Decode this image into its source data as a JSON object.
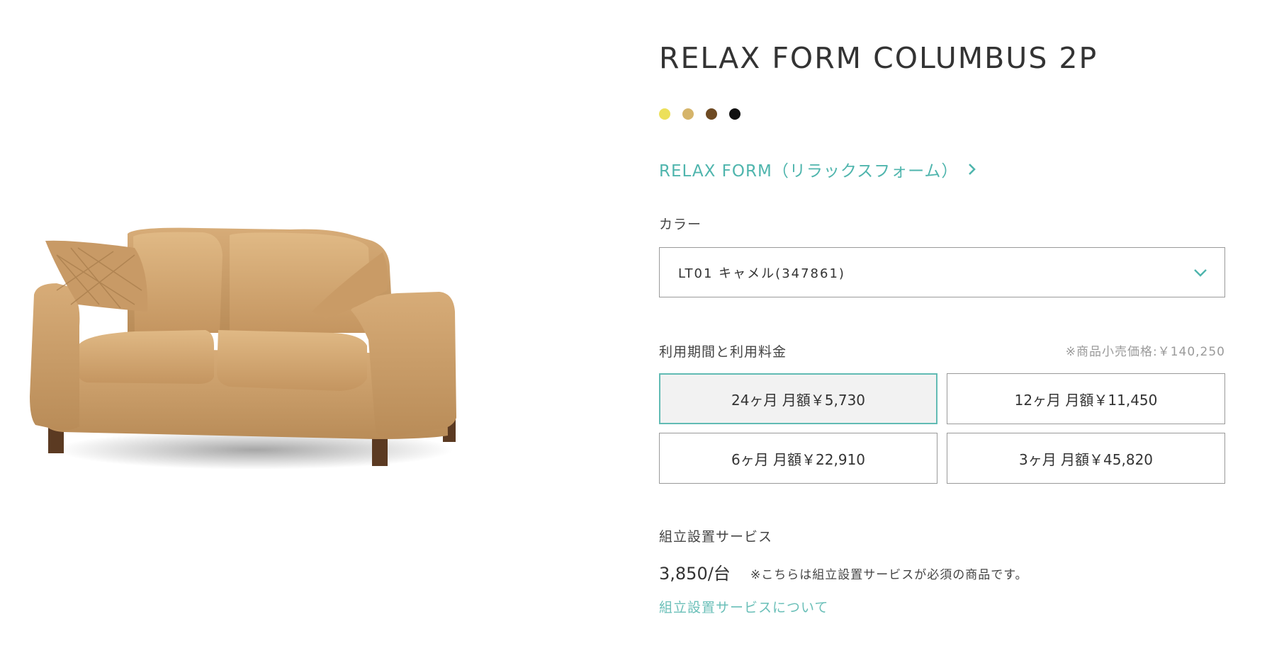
{
  "product": {
    "title": "RELAX FORM COLUMBUS 2P",
    "image_name": "sofa-image"
  },
  "swatches": [
    {
      "name": "yellow",
      "color": "#ece05a"
    },
    {
      "name": "tan",
      "color": "#d5b46a"
    },
    {
      "name": "brown",
      "color": "#6e4a23"
    },
    {
      "name": "black",
      "color": "#111111"
    }
  ],
  "brand_link": {
    "label": "RELAX FORM（リラックスフォーム）",
    "icon": "chevron-right-icon"
  },
  "color": {
    "label": "カラー",
    "selected": "LT01 キャメル(347861)",
    "icon": "chevron-down-icon"
  },
  "rental": {
    "label": "利用期間と利用料金",
    "retail_note": "※商品小売価格:￥140,250",
    "plans": [
      {
        "label": "24ヶ月 月額￥5,730",
        "selected": true
      },
      {
        "label": "12ヶ月 月額￥11,450",
        "selected": false
      },
      {
        "label": "6ヶ月 月額￥22,910",
        "selected": false
      },
      {
        "label": "3ヶ月 月額￥45,820",
        "selected": false
      }
    ]
  },
  "assembly": {
    "label": "組立設置サービス",
    "price": "3,850/台",
    "note": "※こちらは組立設置サービスが必須の商品です。",
    "link": "組立設置サービスについて"
  },
  "colors": {
    "accent": "#4fb5ad",
    "border": "#9a9a9a",
    "selected_border": "#62bbb4",
    "selected_bg": "#f2f2f2"
  }
}
